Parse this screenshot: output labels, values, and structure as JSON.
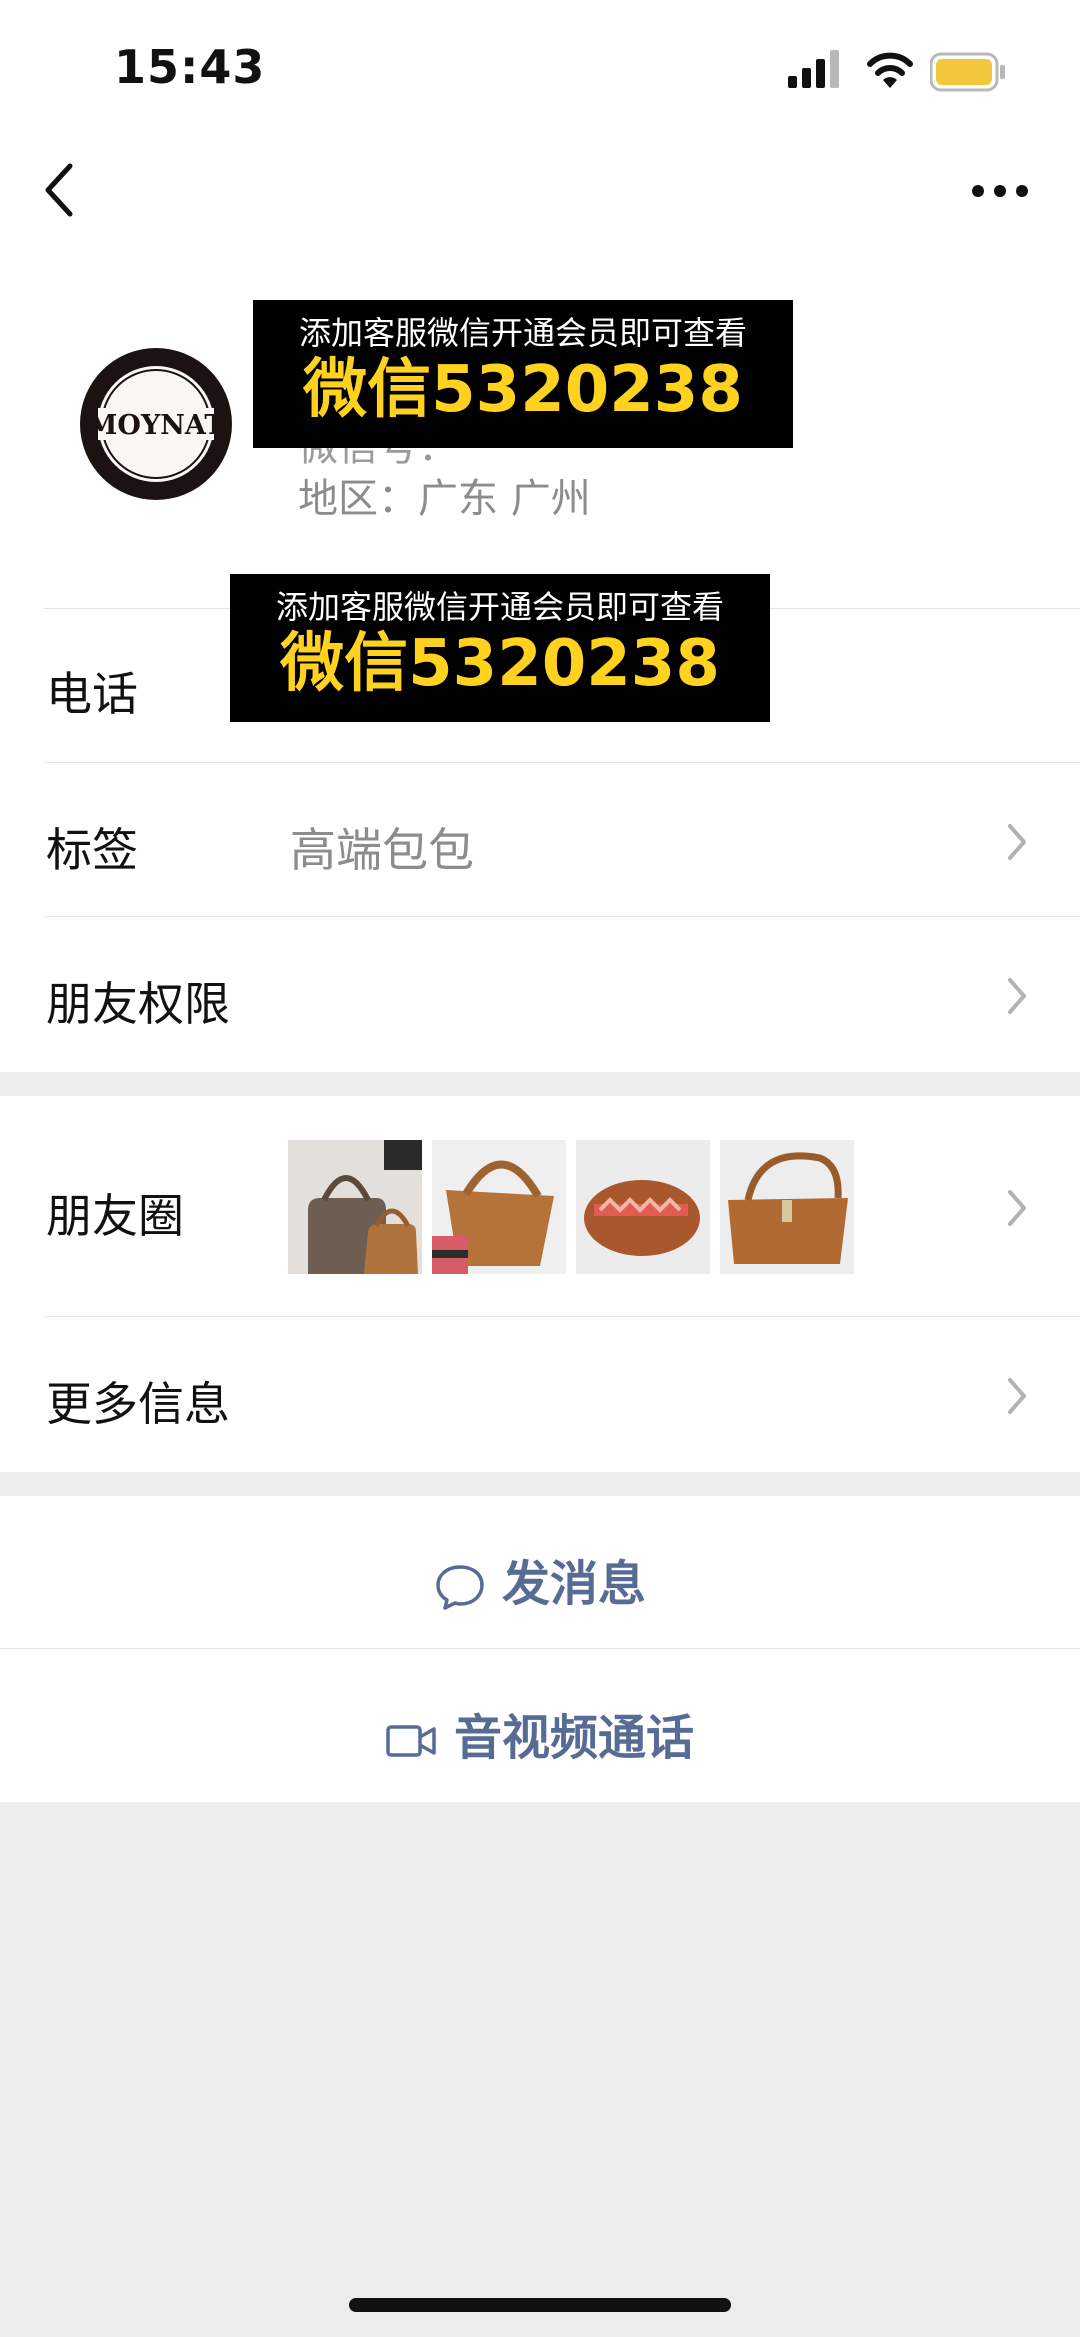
{
  "status_bar": {
    "time": "15:43"
  },
  "profile": {
    "avatar_text": "MOYNAT",
    "wechat_id_obscured": "微信号：",
    "region": "地区：广东 广州"
  },
  "overlay": {
    "line1": "添加客服微信开通会员即可查看",
    "line2": "微信5320238"
  },
  "rows": {
    "phone_label": "电话",
    "tags_label": "标签",
    "tags_value": "高端包包",
    "permissions_label": "朋友权限",
    "moments_label": "朋友圈",
    "more_info_label": "更多信息"
  },
  "actions": {
    "message": "发消息",
    "video_call": "音视频通话"
  },
  "colors": {
    "accent": "#576b95",
    "overlay_highlight": "#ffd21f",
    "background": "#ededed"
  }
}
